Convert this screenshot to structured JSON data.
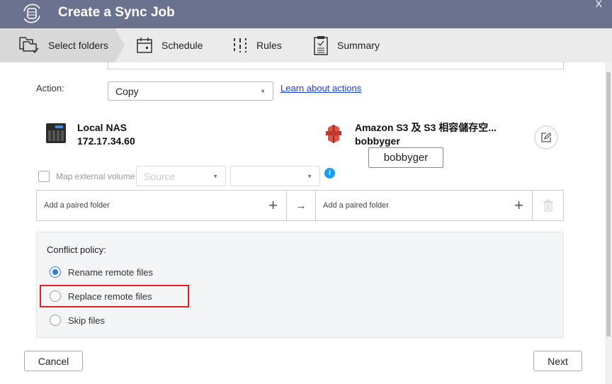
{
  "window": {
    "title": "Create a Sync Job",
    "close": "X"
  },
  "steps": [
    {
      "label": "Select folders",
      "active": true
    },
    {
      "label": "Schedule"
    },
    {
      "label": "Rules"
    },
    {
      "label": "Summary"
    }
  ],
  "action": {
    "label": "Action:",
    "value": "Copy",
    "link": "Learn about actions"
  },
  "source": {
    "name": "Local NAS",
    "address": "172.17.34.60"
  },
  "destination": {
    "name": "Amazon S3 及 S3 相容儲存空...",
    "account": "bobbyger",
    "tooltip": "bobbyger"
  },
  "map_volume": {
    "label": "Map external volume",
    "checked": false,
    "source_placeholder": "Source",
    "target_value": ""
  },
  "pair": {
    "left_placeholder": "Add a paired folder",
    "right_placeholder": "Add a paired folder",
    "arrow": "→"
  },
  "conflict": {
    "title": "Conflict policy:",
    "options": [
      {
        "label": "Rename remote files",
        "selected": true
      },
      {
        "label": "Replace remote files",
        "selected": false
      },
      {
        "label": "Skip files",
        "selected": false
      }
    ]
  },
  "footer": {
    "cancel": "Cancel",
    "next": "Next"
  },
  "colors": {
    "titlebar": "#6b7290",
    "accent": "#2f7be5",
    "highlight": "#e0202a",
    "link": "#1a3fd8"
  }
}
